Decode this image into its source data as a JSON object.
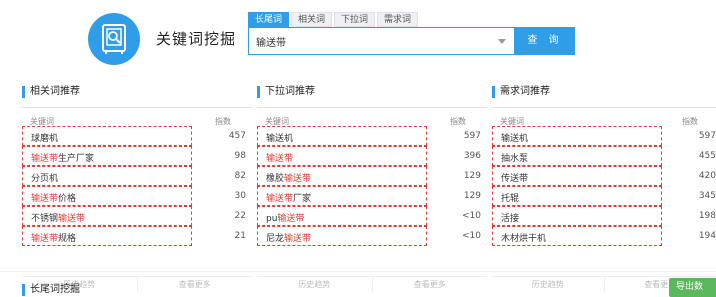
{
  "header": {
    "title": "关键词挖掘",
    "logo_icon": "safe-search-icon",
    "accent_color": "#2f9de8"
  },
  "search": {
    "tabs": [
      {
        "label": "长尾词",
        "active": true
      },
      {
        "label": "相关词",
        "active": false
      },
      {
        "label": "下拉词",
        "active": false
      },
      {
        "label": "需求词",
        "active": false
      }
    ],
    "value": "输送带",
    "button_label": "查 询"
  },
  "panels": [
    {
      "title": "相关词推荐",
      "col_keyword": "关键词",
      "col_index": "指数",
      "rows": [
        {
          "pre": "球磨机",
          "hl": "",
          "post": "",
          "index": "457"
        },
        {
          "pre": "",
          "hl": "输送带",
          "post": "生产厂家",
          "index": "98"
        },
        {
          "pre": "分页机",
          "hl": "",
          "post": "",
          "index": "82"
        },
        {
          "pre": "",
          "hl": "输送带",
          "post": "价格",
          "index": "30"
        },
        {
          "pre": "不锈钢",
          "hl": "输送带",
          "post": "",
          "index": "22"
        },
        {
          "pre": "",
          "hl": "输送带",
          "post": "规格",
          "index": "21"
        }
      ],
      "footer": {
        "history": "历史趋势",
        "more": "查看更多"
      }
    },
    {
      "title": "下拉词推荐",
      "col_keyword": "关键词",
      "col_index": "指数",
      "rows": [
        {
          "pre": "输送机",
          "hl": "",
          "post": "",
          "index": "597"
        },
        {
          "pre": "",
          "hl": "输送带",
          "post": "",
          "index": "396"
        },
        {
          "pre": "橡胶",
          "hl": "输送带",
          "post": "",
          "index": "129"
        },
        {
          "pre": "",
          "hl": "输送带",
          "post": "厂家",
          "index": "129"
        },
        {
          "pre": "pu",
          "hl": "输送带",
          "post": "",
          "index": "<10"
        },
        {
          "pre": "尼龙",
          "hl": "输送带",
          "post": "",
          "index": "<10"
        }
      ],
      "footer": {
        "history": "历史趋势",
        "more": "查看更多"
      }
    },
    {
      "title": "需求词推荐",
      "col_keyword": "关键词",
      "col_index": "指数",
      "rows": [
        {
          "pre": "输送机",
          "hl": "",
          "post": "",
          "index": "597"
        },
        {
          "pre": "抽水泵",
          "hl": "",
          "post": "",
          "index": "455"
        },
        {
          "pre": "传送带",
          "hl": "",
          "post": "",
          "index": "420"
        },
        {
          "pre": "托辊",
          "hl": "",
          "post": "",
          "index": "345"
        },
        {
          "pre": "活接",
          "hl": "",
          "post": "",
          "index": "198"
        },
        {
          "pre": "木材烘干机",
          "hl": "",
          "post": "",
          "index": "194"
        }
      ],
      "footer": {
        "history": "历史趋势",
        "more": "查看更多"
      }
    }
  ],
  "long_tail": {
    "title": "长尾词挖掘",
    "export_label": "导出数"
  },
  "colors": {
    "highlight": "#e53935",
    "export_button": "#5cb85c"
  }
}
